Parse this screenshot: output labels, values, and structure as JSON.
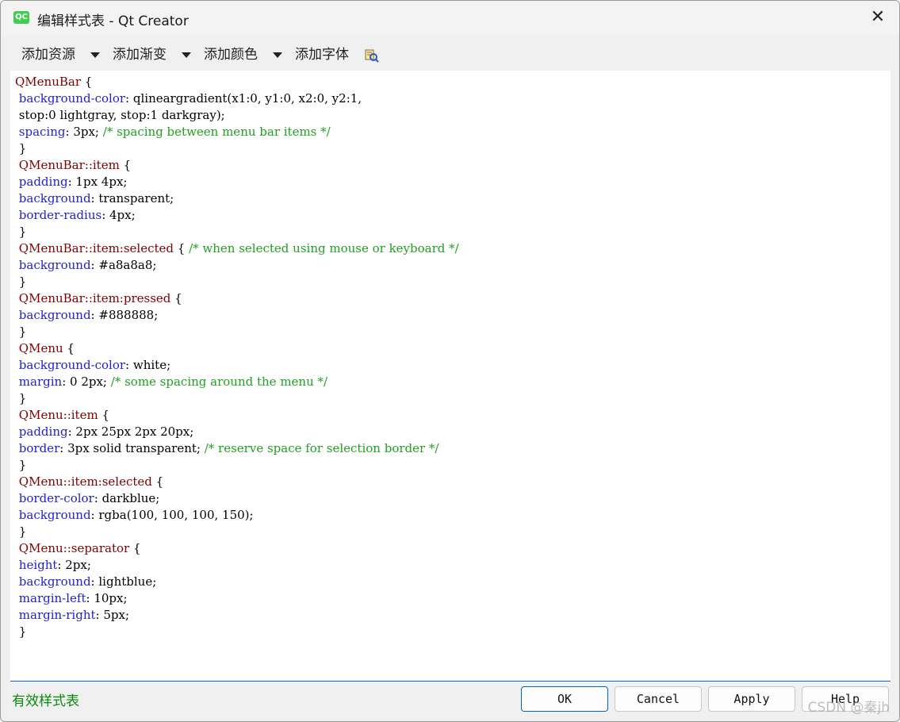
{
  "window": {
    "app_icon": "QC",
    "title": "编辑样式表 - Qt Creator",
    "close_glyph": "✕"
  },
  "toolbar": {
    "add_resource": "添加资源",
    "add_gradient": "添加渐变",
    "add_color": "添加颜色",
    "add_font": "添加字体",
    "font_icon": "font-picker-icon"
  },
  "code_lines": [
    [
      [
        "sel",
        "QMenuBar"
      ],
      [
        "pun",
        " {"
      ]
    ],
    [
      [
        "pun",
        " "
      ],
      [
        "prop",
        "background-color"
      ],
      [
        "pun",
        ": "
      ],
      [
        "val",
        "qlineargradient(x1:0, y1:0, x2:0, y2:1,"
      ]
    ],
    [
      [
        "val",
        " stop:0 lightgray, stop:1 darkgray);"
      ]
    ],
    [
      [
        "pun",
        " "
      ],
      [
        "prop",
        "spacing"
      ],
      [
        "pun",
        ": "
      ],
      [
        "val",
        "3px; "
      ],
      [
        "com",
        "/* spacing between menu bar items */"
      ]
    ],
    [
      [
        "pun",
        " }"
      ]
    ],
    [
      [
        "pun",
        " "
      ],
      [
        "sel",
        "QMenuBar::item"
      ],
      [
        "pun",
        " {"
      ]
    ],
    [
      [
        "pun",
        " "
      ],
      [
        "prop",
        "padding"
      ],
      [
        "pun",
        ": "
      ],
      [
        "val",
        "1px 4px;"
      ]
    ],
    [
      [
        "pun",
        " "
      ],
      [
        "prop",
        "background"
      ],
      [
        "pun",
        ": "
      ],
      [
        "val",
        "transparent;"
      ]
    ],
    [
      [
        "pun",
        " "
      ],
      [
        "prop",
        "border-radius"
      ],
      [
        "pun",
        ": "
      ],
      [
        "val",
        "4px;"
      ]
    ],
    [
      [
        "pun",
        " }"
      ]
    ],
    [
      [
        "pun",
        " "
      ],
      [
        "sel",
        "QMenuBar::item:selected"
      ],
      [
        "pun",
        " { "
      ],
      [
        "com",
        "/* when selected using mouse or keyboard */"
      ]
    ],
    [
      [
        "pun",
        " "
      ],
      [
        "prop",
        "background"
      ],
      [
        "pun",
        ": "
      ],
      [
        "val",
        "#a8a8a8;"
      ]
    ],
    [
      [
        "pun",
        " }"
      ]
    ],
    [
      [
        "pun",
        " "
      ],
      [
        "sel",
        "QMenuBar::item:pressed"
      ],
      [
        "pun",
        " {"
      ]
    ],
    [
      [
        "pun",
        " "
      ],
      [
        "prop",
        "background"
      ],
      [
        "pun",
        ": "
      ],
      [
        "val",
        "#888888;"
      ]
    ],
    [
      [
        "pun",
        " }"
      ]
    ],
    [
      [
        "pun",
        " "
      ],
      [
        "sel",
        "QMenu"
      ],
      [
        "pun",
        " {"
      ]
    ],
    [
      [
        "pun",
        " "
      ],
      [
        "prop",
        "background-color"
      ],
      [
        "pun",
        ": "
      ],
      [
        "val",
        "white;"
      ]
    ],
    [
      [
        "pun",
        " "
      ],
      [
        "prop",
        "margin"
      ],
      [
        "pun",
        ": "
      ],
      [
        "val",
        "0 2px; "
      ],
      [
        "com",
        "/* some spacing around the menu */"
      ]
    ],
    [
      [
        "pun",
        " }"
      ]
    ],
    [
      [
        "pun",
        " "
      ],
      [
        "sel",
        "QMenu::item"
      ],
      [
        "pun",
        " {"
      ]
    ],
    [
      [
        "pun",
        " "
      ],
      [
        "prop",
        "padding"
      ],
      [
        "pun",
        ": "
      ],
      [
        "val",
        "2px 25px 2px 20px;"
      ]
    ],
    [
      [
        "pun",
        " "
      ],
      [
        "prop",
        "border"
      ],
      [
        "pun",
        ": "
      ],
      [
        "val",
        "3px solid transparent; "
      ],
      [
        "com",
        "/* reserve space for selection border */"
      ]
    ],
    [
      [
        "pun",
        " }"
      ]
    ],
    [
      [
        "pun",
        " "
      ],
      [
        "sel",
        "QMenu::item:selected"
      ],
      [
        "pun",
        " {"
      ]
    ],
    [
      [
        "pun",
        " "
      ],
      [
        "prop",
        "border-color"
      ],
      [
        "pun",
        ": "
      ],
      [
        "val",
        "darkblue;"
      ]
    ],
    [
      [
        "pun",
        " "
      ],
      [
        "prop",
        "background"
      ],
      [
        "pun",
        ": "
      ],
      [
        "val",
        "rgba(100, 100, 100, 150);"
      ]
    ],
    [
      [
        "pun",
        " }"
      ]
    ],
    [
      [
        "pun",
        " "
      ],
      [
        "sel",
        "QMenu::separator"
      ],
      [
        "pun",
        " {"
      ]
    ],
    [
      [
        "pun",
        " "
      ],
      [
        "prop",
        "height"
      ],
      [
        "pun",
        ": "
      ],
      [
        "val",
        "2px;"
      ]
    ],
    [
      [
        "pun",
        " "
      ],
      [
        "prop",
        "background"
      ],
      [
        "pun",
        ": "
      ],
      [
        "val",
        "lightblue;"
      ]
    ],
    [
      [
        "pun",
        " "
      ],
      [
        "prop",
        "margin-left"
      ],
      [
        "pun",
        ": "
      ],
      [
        "val",
        "10px;"
      ]
    ],
    [
      [
        "pun",
        " "
      ],
      [
        "prop",
        "margin-right"
      ],
      [
        "pun",
        ": "
      ],
      [
        "val",
        "5px;"
      ]
    ],
    [
      [
        "pun",
        " }"
      ]
    ]
  ],
  "status": {
    "text": "有效样式表"
  },
  "buttons": {
    "ok": "OK",
    "cancel": "Cancel",
    "apply": "Apply",
    "help": "Help"
  },
  "watermark": "CSDN @秦jh",
  "colors": {
    "selector": "#7f0000",
    "property": "#1f1fd0",
    "comment": "#20a020",
    "status_ok": "#0a8a0a",
    "focus_blue": "#0067c0"
  }
}
